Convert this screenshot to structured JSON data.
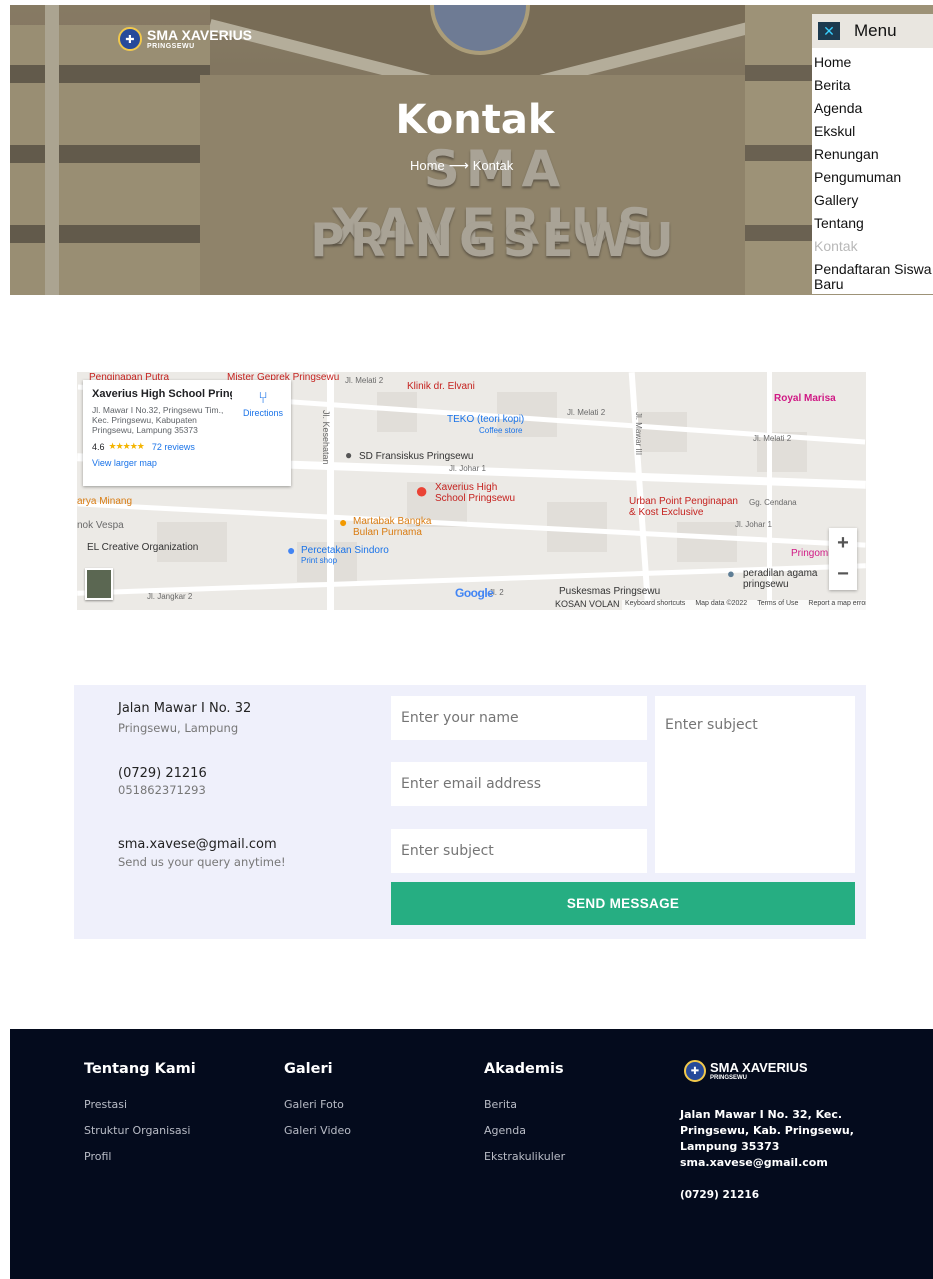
{
  "brand": {
    "name": "SMA XAVERIUS",
    "sub": "PRINGSEWU"
  },
  "hero": {
    "sign_line1": "SMA XAVERIUS",
    "sign_line2": "PRINGSEWU",
    "title": "Kontak",
    "breadcrumb_home": "Home",
    "breadcrumb_current": "Kontak"
  },
  "menu": {
    "label": "Menu",
    "close_icon": "close-x-icon",
    "items": [
      "Home",
      "Berita",
      "Agenda",
      "Ekskul",
      "Renungan",
      "Pengumuman",
      "Gallery",
      "Tentang",
      "Kontak",
      "Pendaftaran Siswa Baru"
    ],
    "active_index": 8
  },
  "map": {
    "card": {
      "title": "Xaverius High School Pringse...",
      "address": "Jl. Mawar I No.32, Pringsewu Tim., Kec. Pringsewu, Kabupaten Pringsewu, Lampung 35373",
      "rating": "4.6",
      "stars": "★★★★★",
      "reviews": "72 reviews",
      "larger": "View larger map",
      "directions": "Directions"
    },
    "labels": {
      "penginapan": "Penginapan Putra",
      "mister": "Mister Geprek Pringsewu",
      "klinik": "Klinik dr. Elvani",
      "melati2a": "Jl. Melati 2",
      "melati2b": "Jl. Melati 2",
      "melati2c": "Jl. Melati 2",
      "royal": "Royal Marisa",
      "teko": "TEKO (teori kopi)",
      "coffee": "Coffee store",
      "kesehatan": "Jl. Kesehatan",
      "mawar": "Jl. Mawar III",
      "sd": "SD Fransiskus Pringsewu",
      "johar": "Jl. Johar 1",
      "xav1": "Xaverius High",
      "xav2": "School Pringsewu",
      "arya": "arya Minang",
      "vespa": "nok Vespa",
      "urban1": "Urban Point Penginapan",
      "urban2": "& Kost Exclusive",
      "cendana": "Gg. Cendana",
      "johar2": "Jl. Johar 1",
      "martabak1": "Martabak Bangka",
      "martabak2": "Bulan Purnama",
      "el": "EL Creative Organization",
      "percetakan": "Percetakan Sindoro",
      "printshop": "Print shop",
      "pringomb": "Pringomb",
      "peradilan1": "peradilan agama",
      "peradilan2": "pringsewu",
      "jangkar": "Jl. Jangkar 2",
      "puskesmas": "Puskesmas Pringsewu",
      "kosan": "KOSAN VOLAN",
      "jl2": "Jl. 2",
      "google": "Google"
    },
    "attribution": [
      "Keyboard shortcuts",
      "Map data ©2022",
      "Terms of Use",
      "Report a map error"
    ],
    "zoom_in": "+",
    "zoom_out": "−"
  },
  "contact": {
    "address_line1": "Jalan Mawar I No. 32",
    "address_line2": "Pringsewu, Lampung",
    "phone_line1": "(0729) 21216",
    "phone_line2": "051862371293",
    "email_line1": "sma.xavese@gmail.com",
    "email_line2": "Send us your query anytime!",
    "name_placeholder": "Enter your name",
    "email_placeholder": "Enter email address",
    "subject_placeholder": "Enter subject",
    "message_placeholder": "Enter subject",
    "send_label": "SEND MESSAGE"
  },
  "footer": {
    "columns": [
      {
        "title": "Tentang Kami",
        "items": [
          "Prestasi",
          "Struktur Organisasi",
          "Profil"
        ]
      },
      {
        "title": "Galeri",
        "items": [
          "Galeri Foto",
          "Galeri Video"
        ]
      },
      {
        "title": "Akademis",
        "items": [
          "Berita",
          "Agenda",
          "Ekstrakulikuler"
        ]
      }
    ],
    "brand_name": "SMA XAVERIUS",
    "brand_sub": "PRINGSEWU",
    "address": "Jalan Mawar I No. 32, Kec. Pringsewu, Kab. Pringsewu, Lampung 35373",
    "email": "sma.xavese@gmail.com",
    "phone": "(0729) 21216"
  },
  "colors": {
    "accent": "#26ae82",
    "footer_bg": "#040b1d",
    "contact_bg": "#eff0fb",
    "menu_active": "#b8b8b8"
  }
}
